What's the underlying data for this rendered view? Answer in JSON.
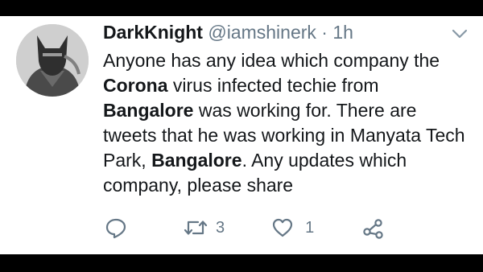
{
  "tweet": {
    "display_name": "DarkKnight",
    "handle": "@iamshinerk",
    "separator": "·",
    "time": "1h",
    "body": {
      "t1": "Anyone has any idea which company the ",
      "b1": "Corona",
      "t2": " virus infected techie from ",
      "b2": "Bangalore",
      "t3": " was working for. There are tweets that he was working in Manyata Tech Park, ",
      "b3": "Bangalore",
      "t4": ". Any updates which company, please share"
    }
  },
  "actions": {
    "reply_icon": "reply-icon",
    "retweet_icon": "retweet-icon",
    "retweet_count": "3",
    "like_icon": "heart-icon",
    "like_count": "1",
    "share_icon": "share-icon"
  },
  "colors": {
    "frame": "#000000",
    "card": "#ffffff",
    "text": "#14171a",
    "muted": "#657786"
  }
}
